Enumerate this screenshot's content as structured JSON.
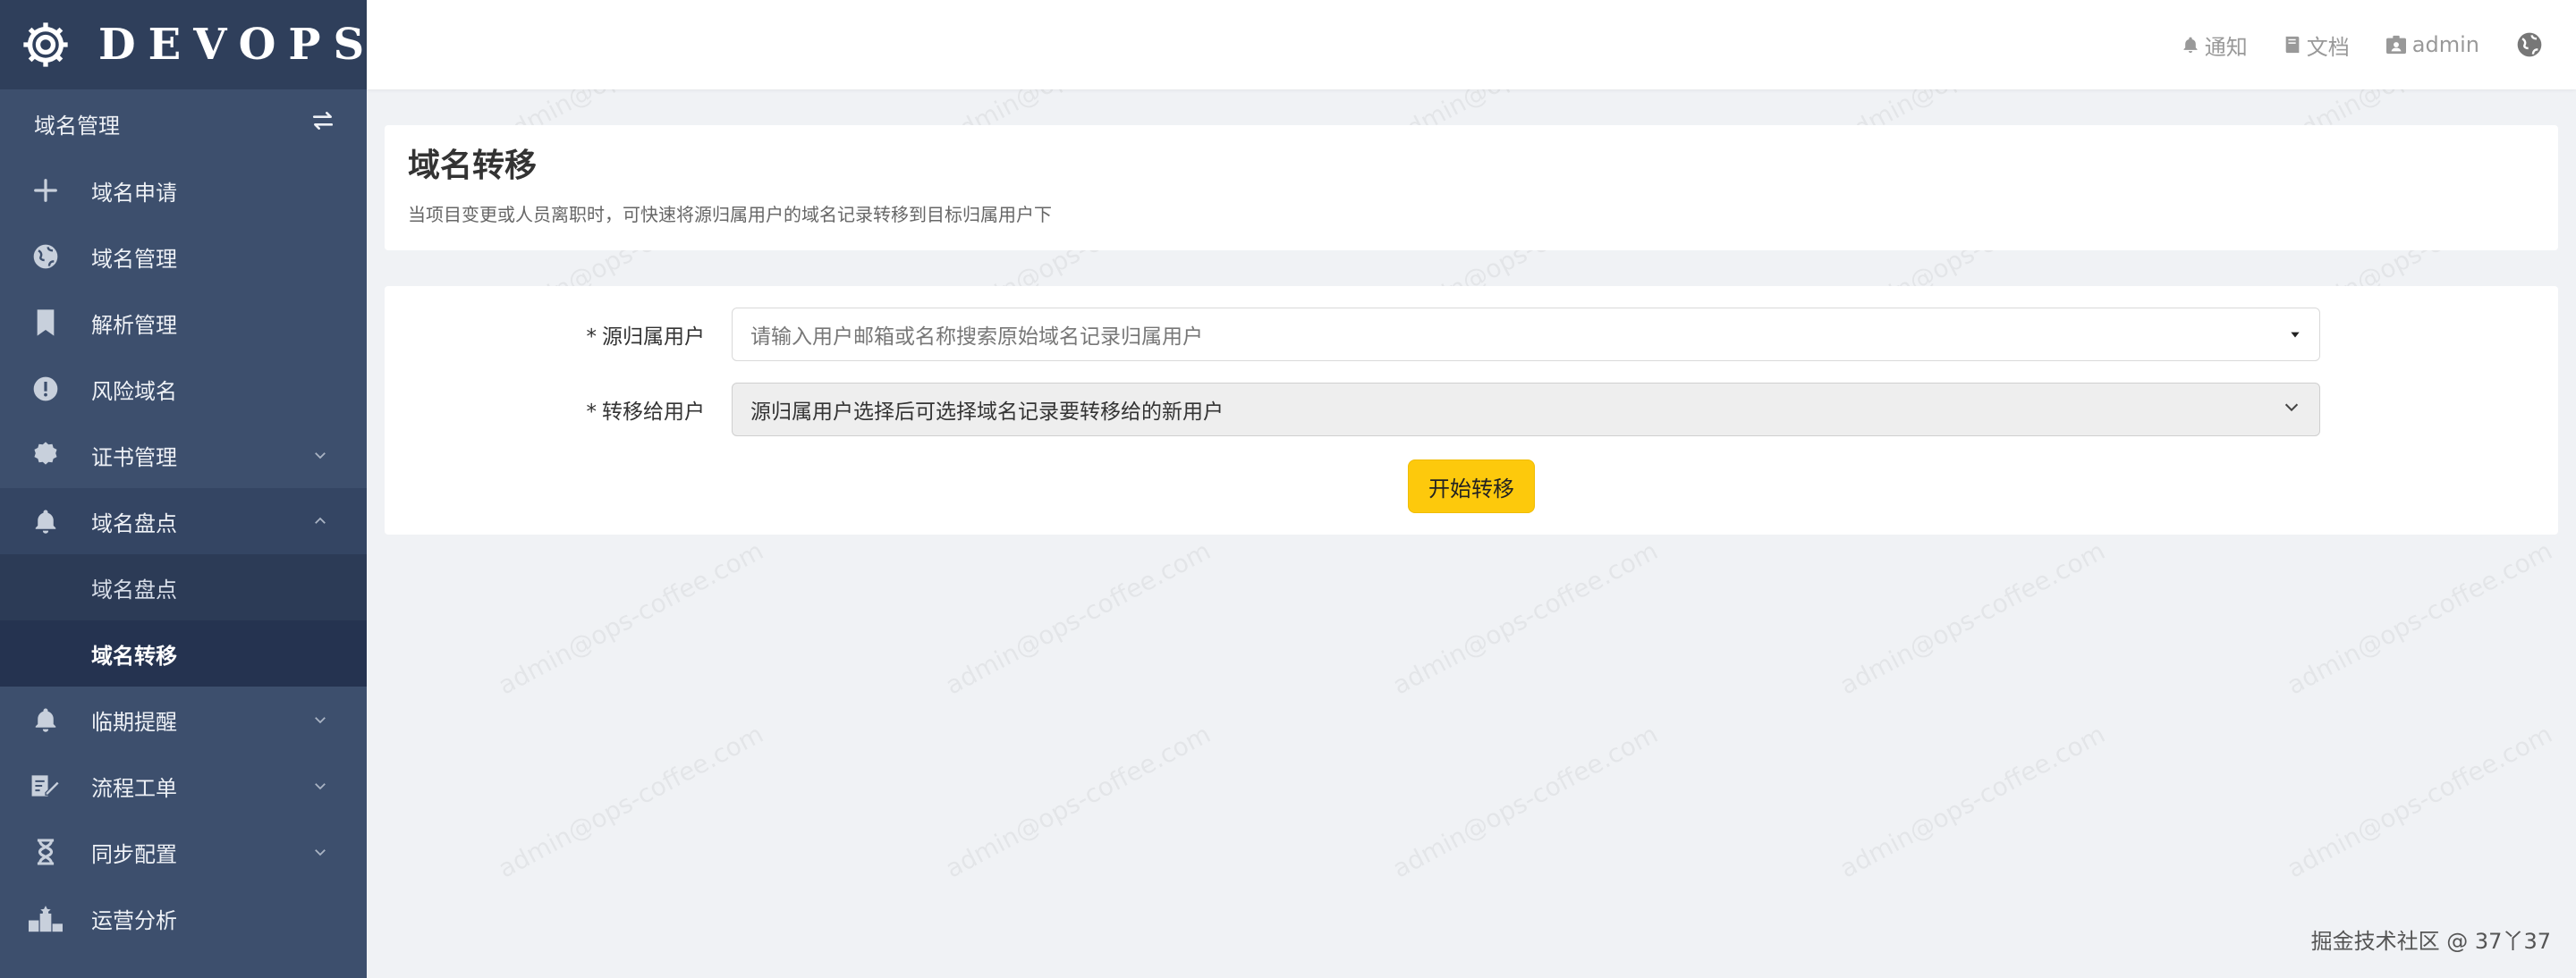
{
  "brand": {
    "name": "DEVOPS",
    "icon": "gear-icon"
  },
  "sidebar": {
    "section_title": "域名管理",
    "section_icon": "swap-icon",
    "items": [
      {
        "label": "域名申请",
        "icon": "plus-icon"
      },
      {
        "label": "域名管理",
        "icon": "globe-icon"
      },
      {
        "label": "解析管理",
        "icon": "bookmark-icon"
      },
      {
        "label": "风险域名",
        "icon": "alert-circle-icon"
      },
      {
        "label": "证书管理",
        "icon": "certificate-icon",
        "chevron": "down"
      },
      {
        "label": "域名盘点",
        "icon": "bell-icon",
        "chevron": "up",
        "open": true,
        "children": [
          {
            "label": "域名盘点"
          },
          {
            "label": "域名转移",
            "active": true
          }
        ]
      },
      {
        "label": "临期提醒",
        "icon": "bell-icon",
        "chevron": "down"
      },
      {
        "label": "流程工单",
        "icon": "edit-document-icon",
        "chevron": "down"
      },
      {
        "label": "同步配置",
        "icon": "hourglass-icon",
        "chevron": "down"
      },
      {
        "label": "运营分析",
        "icon": "podium-icon"
      }
    ]
  },
  "header": {
    "notify_label": "通知",
    "docs_label": "文档",
    "user_label": "admin",
    "language_icon": "globe-icon"
  },
  "page": {
    "title": "域名转移",
    "description": "当项目变更或人员离职时，可快速将源归属用户的域名记录转移到目标归属用户下"
  },
  "form": {
    "source_label": "源归属用户",
    "source_placeholder": "请输入用户邮箱或名称搜索原始域名记录归属用户",
    "target_label": "转移给用户",
    "target_placeholder": "源归属用户选择后可选择域名记录要转移给的新用户",
    "required_mark": "*",
    "submit_label": "开始转移"
  },
  "watermark_text": "admin@ops-coffee.com",
  "footer_mark": "掘金技术社区 @ 37丫37",
  "colors": {
    "sidebar_bg": "#3d4f6d",
    "brand_bg": "#2f3f5b",
    "accent_button": "#fdc90c",
    "page_bg": "#f0f2f5"
  }
}
